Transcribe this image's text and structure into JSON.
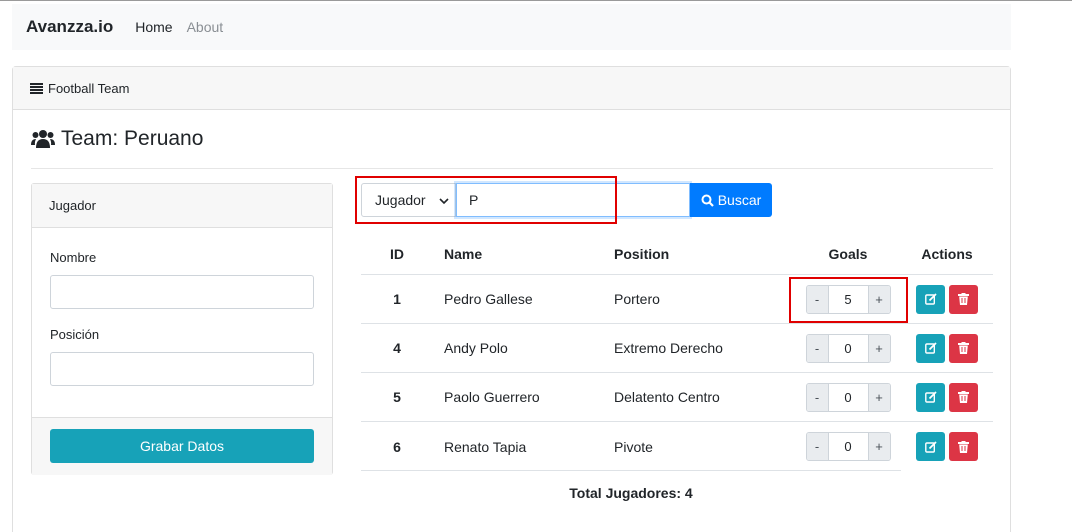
{
  "navbar": {
    "brand": "Avanzza.io",
    "links": [
      {
        "label": "Home"
      },
      {
        "label": "About"
      }
    ]
  },
  "card": {
    "header": "Football Team",
    "header_icon": "list-icon"
  },
  "team": {
    "title": "Team: Peruano",
    "icon": "users-icon"
  },
  "form": {
    "header": "Jugador",
    "nombre_label": "Nombre",
    "nombre_value": "",
    "posicion_label": "Posición",
    "posicion_value": "",
    "save_label": "Grabar Datos"
  },
  "search": {
    "select_value": "Jugador",
    "query": "P",
    "button_label": "Buscar",
    "button_icon": "search-icon"
  },
  "table": {
    "columns": [
      "ID",
      "Name",
      "Position",
      "Goals",
      "Actions"
    ],
    "rows": [
      {
        "id": "1",
        "name": "Pedro Gallese",
        "position": "Portero",
        "goals": "5"
      },
      {
        "id": "4",
        "name": "Andy Polo",
        "position": "Extremo Derecho",
        "goals": "0"
      },
      {
        "id": "5",
        "name": "Paolo Guerrero",
        "position": "Delatento Centro",
        "goals": "0"
      },
      {
        "id": "6",
        "name": "Renato Tapia",
        "position": "Pivote",
        "goals": "0"
      }
    ],
    "stepper_minus": "-",
    "stepper_plus": "+"
  },
  "total": "Total Jugadores: 4",
  "colors": {
    "primary": "#007bff",
    "info": "#17a2b8",
    "danger": "#dc3545",
    "highlight": "#e00000"
  }
}
